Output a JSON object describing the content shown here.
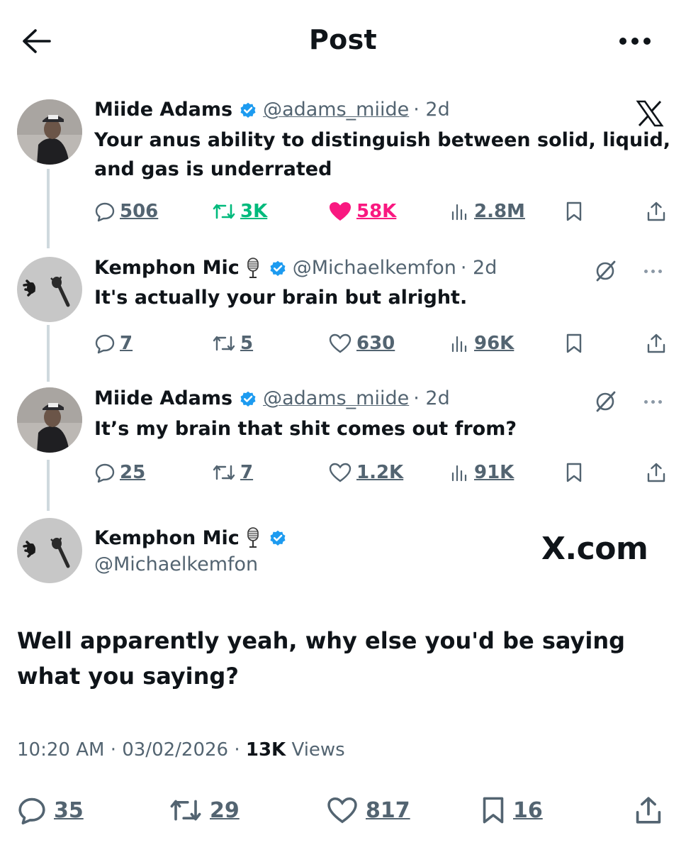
{
  "header": {
    "title": "Post",
    "back_icon": "arrow-left-icon",
    "more_icon": "more-horizontal-icon"
  },
  "tweets": [
    {
      "display_name": "Miide Adams",
      "handle": "@adams_miide",
      "time": "· 2d",
      "verified": true,
      "text": "Your anus ability to distinguish between solid, liquid, and gas is underrated",
      "replies": "506",
      "reposts": "3K",
      "likes": "58K",
      "views": "2.8M",
      "liked": true,
      "reposted": true
    },
    {
      "display_name": "Kemphon Mic",
      "handle": "@Michaelkemfon",
      "time": "· 2d",
      "verified": true,
      "text": "It's actually your brain but alright.",
      "replies": "7",
      "reposts": "5",
      "likes": "630",
      "views": "96K"
    },
    {
      "display_name": "Miide Adams",
      "handle": "@adams_miide",
      "time": "· 2d",
      "verified": true,
      "text": "It’s my brain that shit comes out from?",
      "replies": "25",
      "reposts": "7",
      "likes": "1.2K",
      "views": "91K"
    }
  ],
  "main_tweet": {
    "display_name": "Kemphon Mic",
    "handle": "@Michaelkemfon",
    "text": "Well apparently yeah, why else you'd be saying what you saying?",
    "time": "10:20 AM",
    "date": "03/02/2026",
    "views_count": "13K",
    "views_label": "Views",
    "replies": "35",
    "reposts": "29",
    "likes": "817",
    "bookmarks": "16"
  },
  "watermark": {
    "x_logo_text": "X.com"
  },
  "colors": {
    "text": "#0f1419",
    "secondary": "#536471",
    "verified": "#1d9bf0",
    "repost_green": "#00ba7c",
    "like_pink": "#f91880",
    "thread_line": "#cfd9de"
  }
}
